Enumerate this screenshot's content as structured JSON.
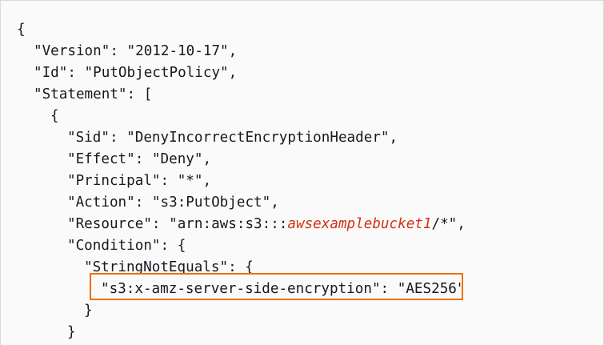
{
  "policy": {
    "open_brace": "{",
    "version_line": "\"Version\": \"2012-10-17\",",
    "id_line": "\"Id\": \"PutObjectPolicy\",",
    "statement_line": "\"Statement\": [",
    "statement_open_brace": "{",
    "sid_line": "\"Sid\": \"DenyIncorrectEncryptionHeader\",",
    "effect_line": "\"Effect\": \"Deny\",",
    "principal_line": "\"Principal\": \"*\",",
    "action_line": "\"Action\": \"s3:PutObject\",",
    "resource_prefix": "\"Resource\": \"arn:aws:s3:::",
    "resource_bucket_placeholder": "awsexamplebucket1",
    "resource_suffix": "/*\",",
    "condition_line": "\"Condition\": {",
    "string_not_equals_line": "\"StringNotEquals\": {",
    "encryption_line": "\"s3:x-amz-server-side-encryption\": \"AES256\"",
    "close_brace_inner": "}",
    "close_brace_condition": "}"
  },
  "colors": {
    "highlight_box": "#ec7211",
    "placeholder_text": "#d13212",
    "code_text": "#16191f",
    "panel_background": "#fafafa"
  }
}
